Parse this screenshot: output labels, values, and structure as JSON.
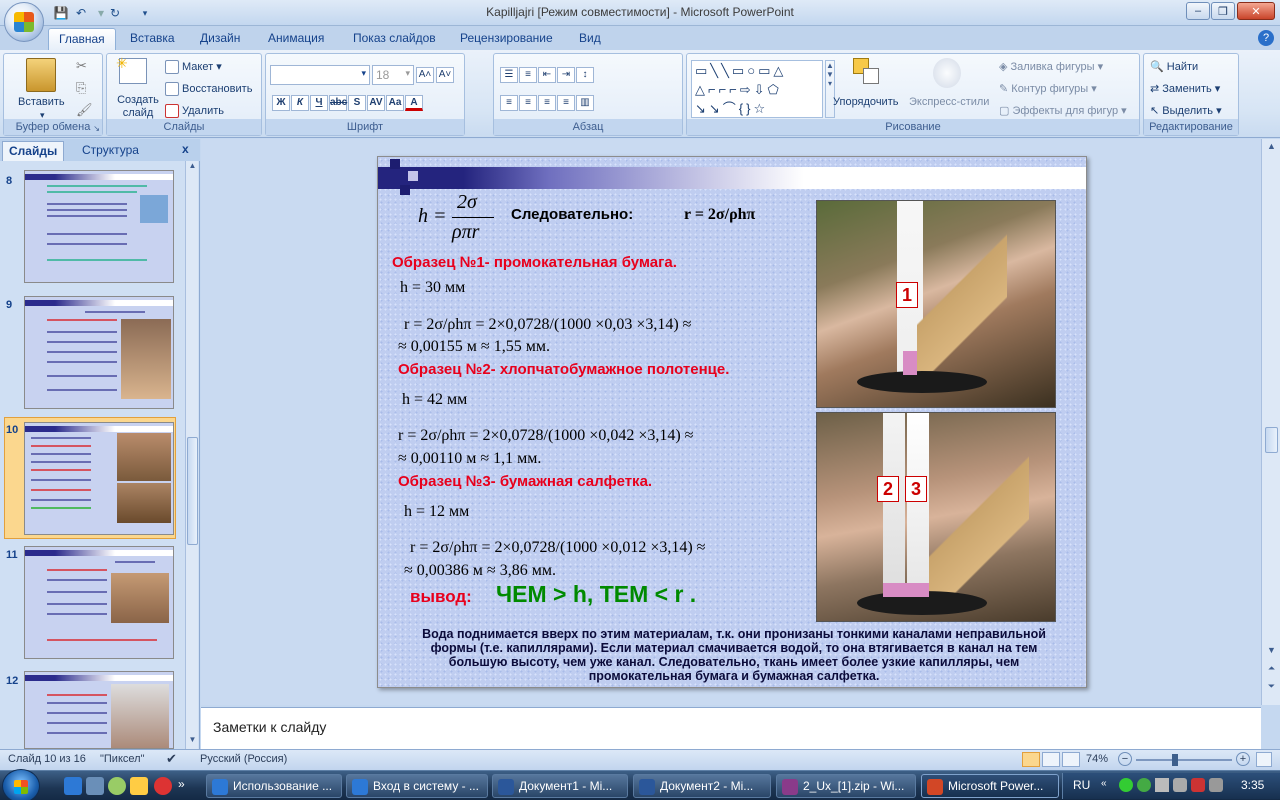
{
  "window": {
    "title": "Kapilljajri [Режим совместимости] - Microsoft PowerPoint",
    "min": "–",
    "max": "❐",
    "close": "✕"
  },
  "tabs": [
    "Главная",
    "Вставка",
    "Дизайн",
    "Анимация",
    "Показ слайдов",
    "Рецензирование",
    "Вид"
  ],
  "ribbon": {
    "clipboard": {
      "paste": "Вставить",
      "label": "Буфер обмена"
    },
    "slides": {
      "create": "Создать слайд",
      "layout": "Макет",
      "reset": "Восстановить",
      "delete": "Удалить",
      "label": "Слайды"
    },
    "font": {
      "size": "18",
      "label": "Шрифт",
      "bold": "Ж",
      "italic": "К",
      "underline": "Ч",
      "strike": "abc",
      "shadow": "S",
      "spacing": "AV",
      "case": "Aa",
      "color": "A"
    },
    "paragraph": {
      "label": "Абзац"
    },
    "drawing": {
      "arrange": "Упорядочить",
      "quickstyles": "Экспресс-стили",
      "fill": "Заливка фигуры",
      "outline": "Контур фигуры",
      "effects": "Эффекты для фигур",
      "label": "Рисование"
    },
    "editing": {
      "find": "Найти",
      "replace": "Заменить",
      "select": "Выделить",
      "label": "Редактирование"
    }
  },
  "pane": {
    "tab_slides": "Слайды",
    "tab_outline": "Структура",
    "close": "x"
  },
  "thumbnails": [
    {
      "num": "8"
    },
    {
      "num": "9"
    },
    {
      "num": "10"
    },
    {
      "num": "11"
    },
    {
      "num": "12"
    }
  ],
  "slide": {
    "formula_h": "h =",
    "frac_num": "2σ",
    "frac_den": "ρπr",
    "therefore": "Следовательно:",
    "r_formula": "r = 2σ/ρhπ",
    "s1_title": "Образец №1- промокательная бумага.",
    "s1_h": "h = 30 мм",
    "s1_r1": "r = 2σ/ρhπ =  2×0,0728/(1000 ×0,03 ×3,14) ≈",
    "s1_r2": "≈ 0,00155 м  ≈ 1,55 мм.",
    "s2_title": "Образец №2- хлопчатобумажное полотенце.",
    "s2_h": "h = 42 мм",
    "s2_r1": "r = 2σ/ρhπ =  2×0,0728/(1000 ×0,042 ×3,14) ≈",
    "s2_r2": "≈ 0,00110 м  ≈ 1,1 мм.",
    "s3_title": "Образец №3- бумажная салфетка.",
    "s3_h": "h = 12 мм",
    "s3_r1": "r = 2σ/ρhπ =  2×0,0728/(1000 ×0,012 ×3,14) ≈",
    "s3_r2": "≈ 0,00386 м  ≈ 3,86 мм.",
    "conclusion_label": "вывод:",
    "conclusion_text": "ЧЕМ > h, ТЕМ < r .",
    "bottom_text": "Вода поднимается вверх по этим материалам, т.к. они пронизаны тонкими каналами неправильной формы (т.е. капиллярами). Если материал смачивается водой, то она втягивается в канал на тем большую высоту, чем уже канал. Следовательно, ткань имеет более узкие капилляры, чем промокательная бумага и бумажная салфетка.",
    "label1": "1",
    "label2": "2",
    "label3": "3",
    "label3b": "3"
  },
  "notes": {
    "placeholder": "Заметки к слайду"
  },
  "status": {
    "slide_of": "Слайд 10 из 16",
    "theme": "\"Пиксел\"",
    "lang": "Русский (Россия)",
    "zoom": "74%"
  },
  "taskbar": {
    "items": [
      "Использование ...",
      "Вход в систему - ...",
      "Документ1 - Mi...",
      "Документ2 - Mi...",
      "2_Ux_[1].zip - Wi...",
      "Microsoft Power..."
    ],
    "lang": "RU",
    "time": "3:35"
  },
  "colors": {
    "accent": "#15428b",
    "sample_red": "#e8001c",
    "conclusion_green": "#008a00"
  }
}
